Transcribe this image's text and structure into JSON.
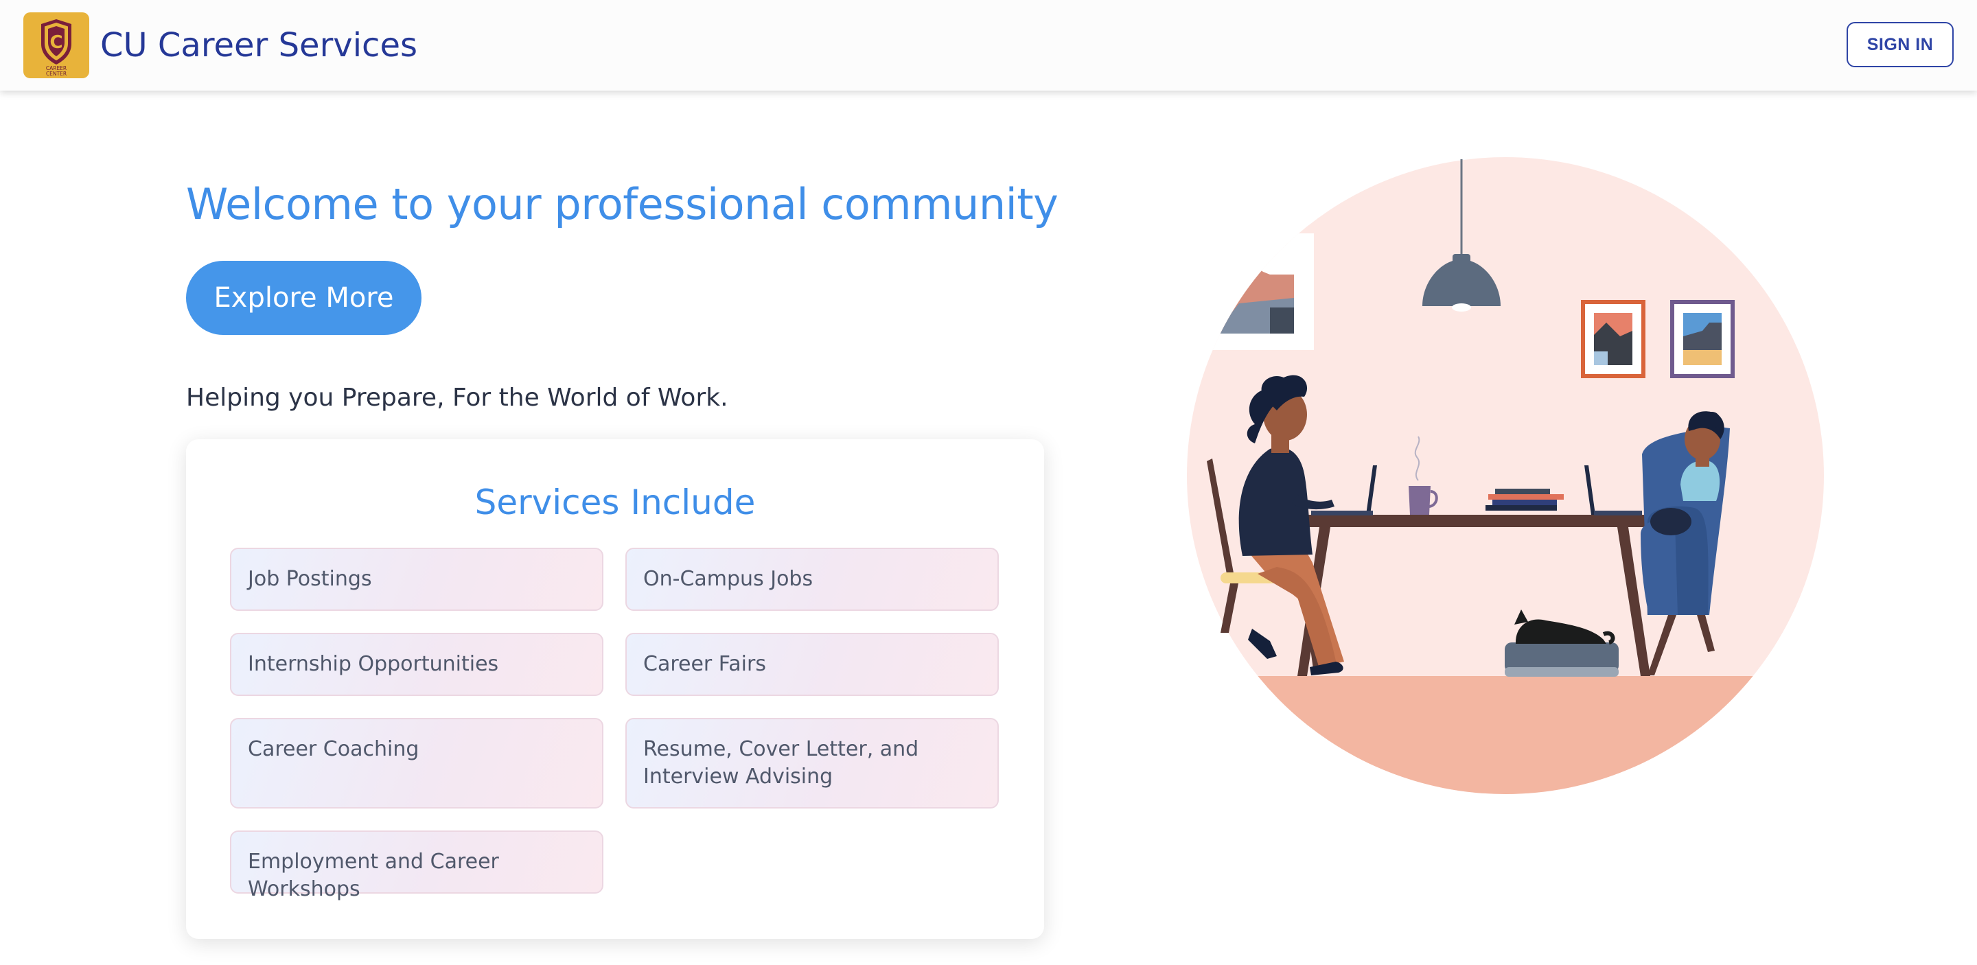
{
  "header": {
    "logo_text": "CAREER CENTER",
    "title": "CU Career Services",
    "sign_in_label": "SIGN IN"
  },
  "hero": {
    "title": "Welcome to your professional community",
    "cta_label": "Explore More",
    "tagline": "Helping you Prepare, For the World of Work."
  },
  "services": {
    "title": "Services Include",
    "items": [
      {
        "label": "Job Postings"
      },
      {
        "label": "On-Campus Jobs"
      },
      {
        "label": "Internship Opportunities"
      },
      {
        "label": "Career Fairs"
      },
      {
        "label": "Career Coaching"
      },
      {
        "label": "Resume, Cover Letter, and Interview Advising"
      },
      {
        "label": "Employment and Career Workshops"
      }
    ]
  },
  "colors": {
    "brand_navy": "#253897",
    "accent_blue": "#4596ea",
    "logo_gold": "#e8b33a",
    "illustration_bg": "#fde8e4"
  },
  "illustration": {
    "icon": "remote-work-illustration"
  }
}
